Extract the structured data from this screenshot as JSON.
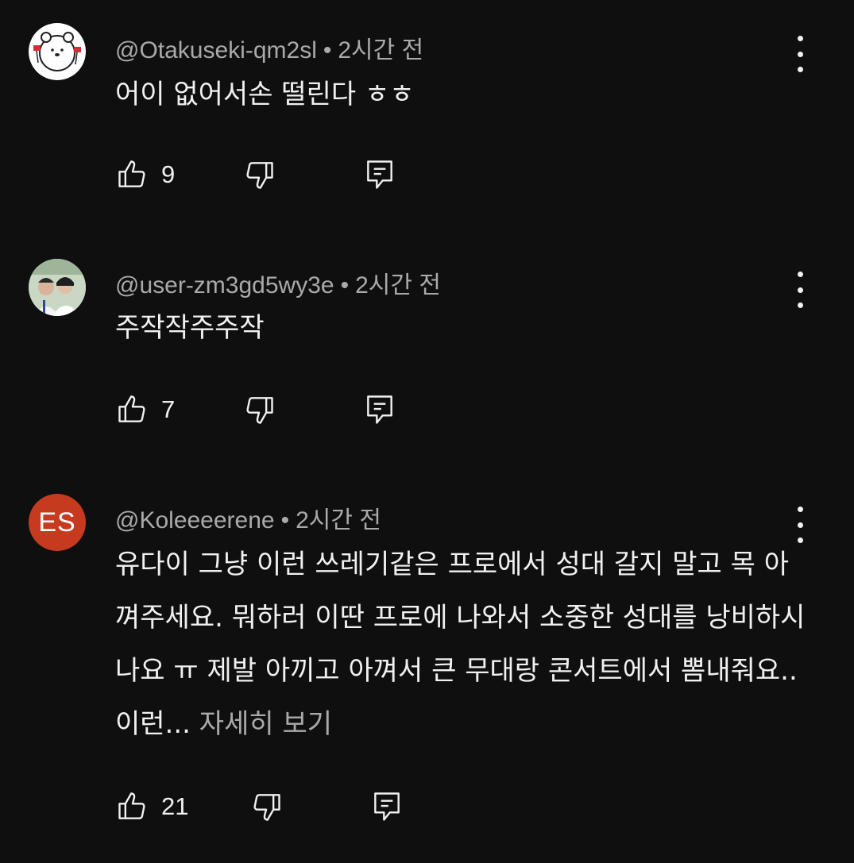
{
  "comments": [
    {
      "author": "@Otakuseki-qm2sl",
      "separator": "•",
      "time": "2시간 전",
      "text": "어이 없어서손 떨린다 ㅎㅎ",
      "likes": "9",
      "avatar": "bear-illustration"
    },
    {
      "author": "@user-zm3gd5wy3e",
      "separator": "•",
      "time": "2시간 전",
      "text": "주작작주주작",
      "likes": "7",
      "avatar": "group-photo"
    },
    {
      "author": "@Koleeeerene",
      "separator": "•",
      "time": "2시간 전",
      "text": "유다이 그냥 이런 쓰레기같은 프로에서 성대 갈지 말고 목 아껴주세요. 뭐하러 이딴 프로에 나와서 소중한 성대를 낭비하시나요 ㅠ 제발 아끼고 아껴서 큰 무대랑 콘서트에서 뽐내줘요.. 이런...",
      "more": "자세히 보기",
      "likes": "21",
      "avatar_initials": "ES"
    }
  ],
  "colors": {
    "background": "#0f0f0f",
    "text": "#f1f1f1",
    "secondary": "#aaaaaa",
    "avatar_es": "#c63a1f"
  },
  "icons": [
    "thumbs-up-icon",
    "thumbs-down-icon",
    "reply-icon",
    "more-vert-icon"
  ]
}
